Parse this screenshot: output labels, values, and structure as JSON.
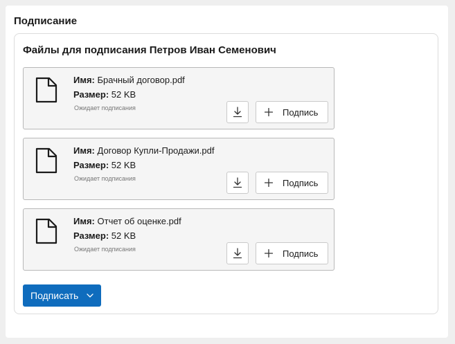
{
  "section": {
    "title": "Подписание"
  },
  "card": {
    "title": "Файлы для подписания Петров Иван Семенович"
  },
  "labels": {
    "name": "Имя:",
    "size": "Размер:"
  },
  "files": [
    {
      "name": "Брачный договор.pdf",
      "size": "52 KB",
      "status": "Ожидает подписания",
      "sign_label": "Подпись"
    },
    {
      "name": "Договор Купли-Продажи.pdf",
      "size": "52 KB",
      "status": "Ожидает подписания",
      "sign_label": "Подпись"
    },
    {
      "name": "Отчет об оценке.pdf",
      "size": "52 KB",
      "status": "Ожидает подписания",
      "sign_label": "Подпись"
    }
  ],
  "actions": {
    "sign_all_label": "Подписать"
  },
  "colors": {
    "primary": "#0f6cbd",
    "file_bg": "#f5f5f5",
    "page_bg": "#efefef"
  },
  "icons": {
    "file": "document-icon",
    "download": "download-icon",
    "add": "plus-icon",
    "dropdown": "chevron-down-icon"
  }
}
